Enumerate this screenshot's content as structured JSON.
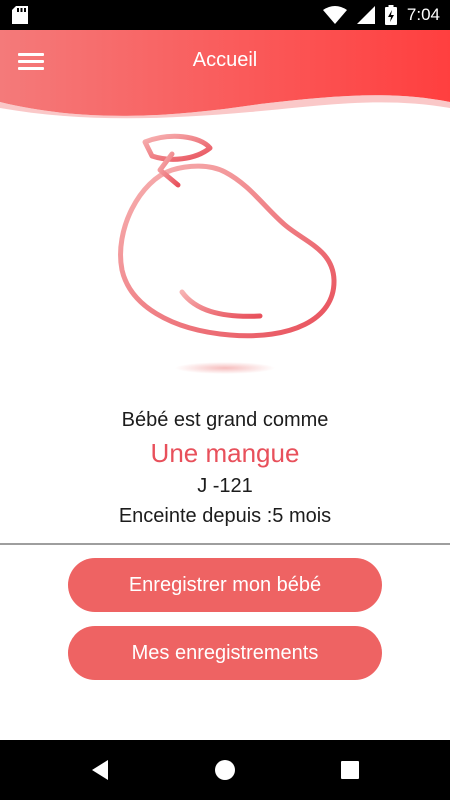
{
  "status_bar": {
    "time": "7:04",
    "icons": [
      "sd-card-icon",
      "wifi-icon",
      "signal-icon",
      "battery-charging-icon"
    ]
  },
  "header": {
    "title": "Accueil",
    "menu_icon": "hamburger-menu-icon"
  },
  "illustration": {
    "icon": "mango-icon",
    "color": "#e8505b"
  },
  "info": {
    "size_label": "Bébé est grand comme",
    "fruit_name": "Une mangue",
    "countdown": "J -121",
    "pregnancy_duration": "Enceinte depuis :5 mois"
  },
  "actions": {
    "record_label": "Enregistrer mon bébé",
    "recordings_label": "Mes enregistrements"
  },
  "nav_bar": {
    "icons": [
      "back-icon",
      "home-icon",
      "recents-icon"
    ]
  },
  "colors": {
    "accent": "#e8505b",
    "button": "#ee6363",
    "header_gradient_start": "#f47a7a",
    "header_gradient_end": "#ff3f3f"
  }
}
